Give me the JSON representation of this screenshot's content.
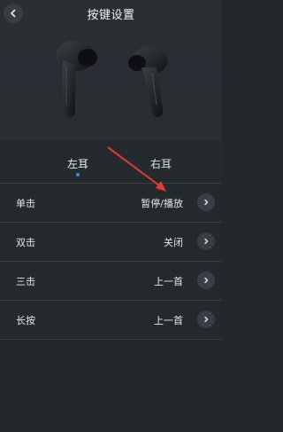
{
  "header": {
    "title": "按键设置"
  },
  "tabs": [
    {
      "label": "左耳",
      "active": true
    },
    {
      "label": "右耳",
      "active": false
    }
  ],
  "settings": [
    {
      "label": "单击",
      "value": "暂停/播放"
    },
    {
      "label": "双击",
      "value": "关闭"
    },
    {
      "label": "三击",
      "value": "上一首"
    },
    {
      "label": "长按",
      "value": "上一首"
    }
  ],
  "colors": {
    "background": "#23262b",
    "accent": "#3b8cff",
    "annotation_arrow": "#e53935"
  },
  "icons": [
    "back-chevron-icon",
    "chevron-right-icon",
    "earbuds-image"
  ]
}
